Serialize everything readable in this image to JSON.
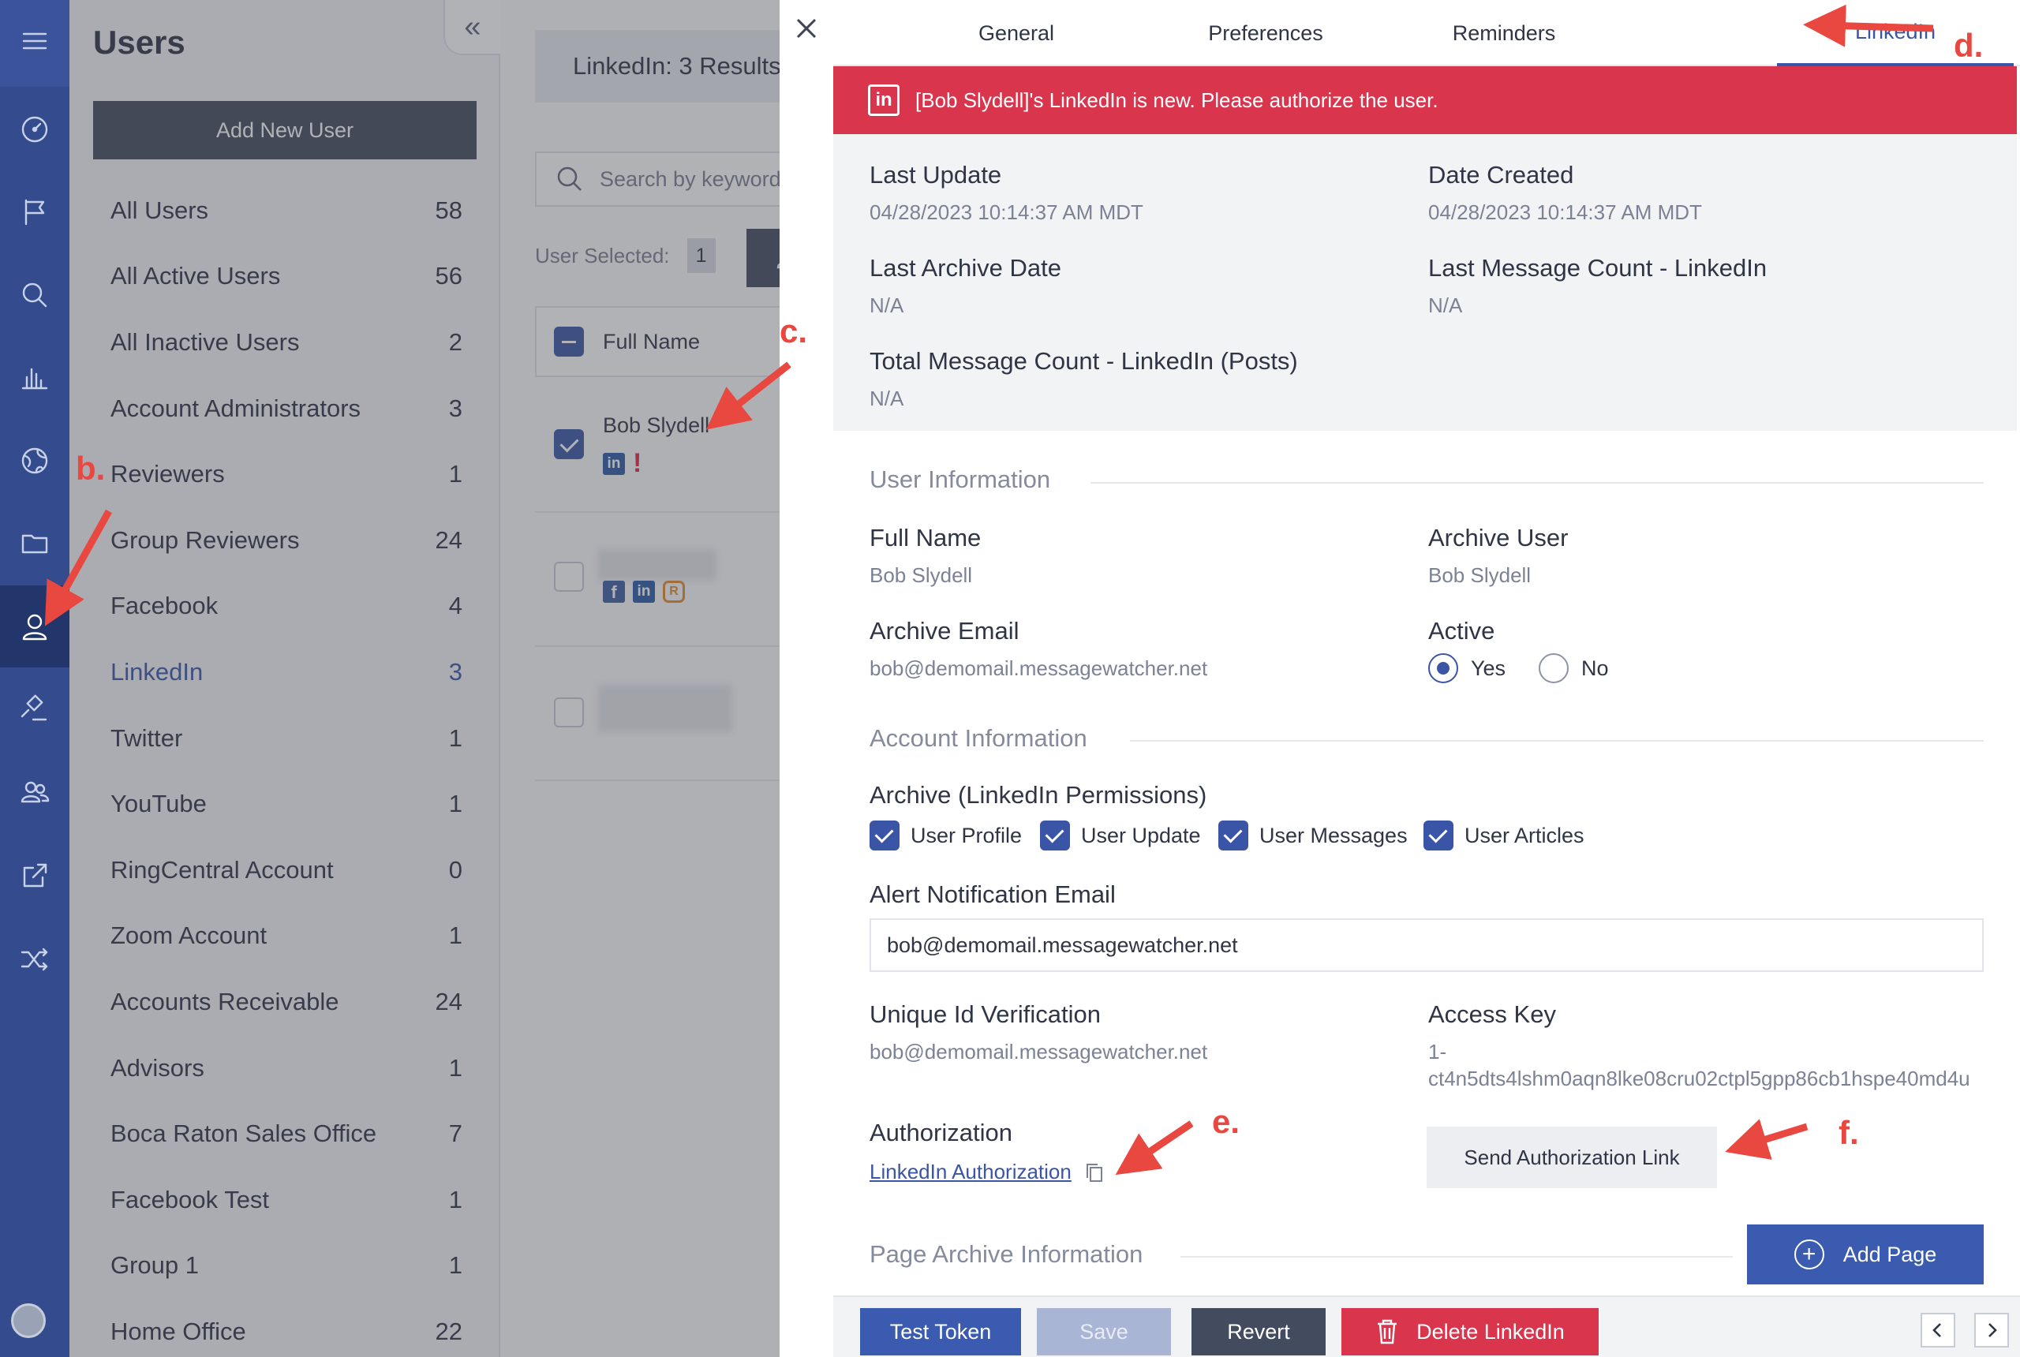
{
  "colors": {
    "rail": "#344c8d",
    "accent": "#3a55a5",
    "alert": "#d9364e",
    "annotation": "#e8483f"
  },
  "nav_rail": {
    "icons": [
      "menu-icon",
      "dashboard-icon",
      "flag-icon",
      "search-icon",
      "chart-icon",
      "globe-icon",
      "folder-icon",
      "user-icon",
      "gavel-icon",
      "group-icon",
      "export-icon",
      "shuffle-icon"
    ]
  },
  "users_panel": {
    "title": "Users",
    "collapse_glyph": "«",
    "add_button": "Add New User",
    "groups": [
      {
        "label": "All Users",
        "count": "58"
      },
      {
        "label": "All Active Users",
        "count": "56"
      },
      {
        "label": "All Inactive Users",
        "count": "2"
      },
      {
        "label": "Account Administrators",
        "count": "3"
      },
      {
        "label": "Reviewers",
        "count": "1"
      },
      {
        "label": "Group Reviewers",
        "count": "24"
      },
      {
        "label": "Facebook",
        "count": "4"
      },
      {
        "label": "LinkedIn",
        "count": "3"
      },
      {
        "label": "Twitter",
        "count": "1"
      },
      {
        "label": "YouTube",
        "count": "1"
      },
      {
        "label": "RingCentral Account",
        "count": "0"
      },
      {
        "label": "Zoom Account",
        "count": "1"
      },
      {
        "label": "Accounts Receivable",
        "count": "24"
      },
      {
        "label": "Advisors",
        "count": "1"
      },
      {
        "label": "Boca Raton Sales Office",
        "count": "7"
      },
      {
        "label": "Facebook Test",
        "count": "1"
      },
      {
        "label": "Group 1",
        "count": "1"
      },
      {
        "label": "Home Office",
        "count": "22"
      }
    ]
  },
  "list_panel": {
    "results": "LinkedIn: 3 Results",
    "search_placeholder": "Search by keyword...",
    "user_selected_label": "User Selected:",
    "user_selected_count": "1",
    "action_label": "A",
    "column_header": "Full Name",
    "rows": [
      {
        "name": "Bob Slydell"
      }
    ]
  },
  "drawer": {
    "tabs": [
      "General",
      "Preferences",
      "Reminders",
      "LinkedIn"
    ],
    "alert_icon": "in",
    "alert": "[Bob Slydell]'s LinkedIn is new. Please authorize the user.",
    "summary": {
      "last_update_label": "Last Update",
      "last_update": "04/28/2023 10:14:37 AM MDT",
      "date_created_label": "Date Created",
      "date_created": "04/28/2023 10:14:37 AM MDT",
      "last_archive_label": "Last Archive Date",
      "last_archive": "N/A",
      "last_msg_count_label": "Last Message Count - LinkedIn",
      "last_msg_count": "N/A",
      "total_msg_label": "Total Message Count - LinkedIn (Posts)",
      "total_msg": "N/A"
    },
    "user_info": {
      "section": "User Information",
      "full_name_label": "Full Name",
      "full_name": "Bob Slydell",
      "archive_user_label": "Archive User",
      "archive_user": "Bob Slydell",
      "archive_email_label": "Archive Email",
      "archive_email": "bob@demomail.messagewatcher.net",
      "active_label": "Active",
      "active_yes": "Yes",
      "active_no": "No"
    },
    "account_info": {
      "section": "Account Information",
      "permissions_label": "Archive (LinkedIn Permissions)",
      "permissions": [
        "User Profile",
        "User Update",
        "User Messages",
        "User Articles"
      ],
      "alert_email_label": "Alert Notification Email",
      "alert_email": "bob@demomail.messagewatcher.net",
      "unique_id_label": "Unique Id Verification",
      "unique_id": "bob@demomail.messagewatcher.net",
      "access_key_label": "Access Key",
      "access_key_line1": "1-",
      "access_key_line2": "ct4n5dts4lshm0aqn8lke08cru02ctpl5gpp86cb1hspe40md4u",
      "authorization_label": "Authorization",
      "authorization_link": "LinkedIn Authorization",
      "send_auth_button": "Send Authorization Link"
    },
    "page_archive": {
      "section": "Page Archive Information",
      "add_page_button": "Add Page"
    },
    "footer": {
      "test_token": "Test Token",
      "save": "Save",
      "revert": "Revert",
      "delete": "Delete LinkedIn"
    }
  },
  "annotations": {
    "b": "b.",
    "c": "c.",
    "d": "d.",
    "e": "e.",
    "f": "f."
  }
}
